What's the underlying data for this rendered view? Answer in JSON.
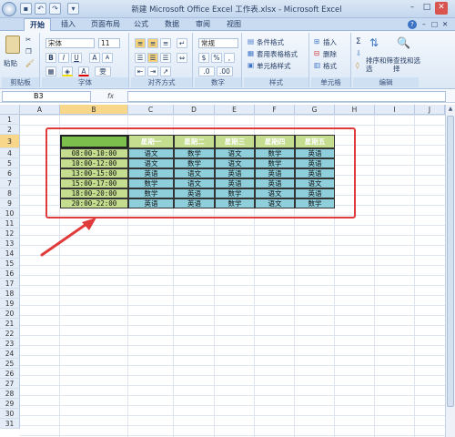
{
  "window": {
    "title": "新建 Microsoft Office Excel 工作表.xlsx - Microsoft Excel"
  },
  "tabs": [
    "开始",
    "插入",
    "页面布局",
    "公式",
    "数据",
    "审阅",
    "视图"
  ],
  "ribbon": {
    "clipboard": {
      "paste": "粘贴",
      "label": "剪贴板"
    },
    "font": {
      "name": "宋体",
      "size": "11",
      "label": "字体"
    },
    "alignment": {
      "label": "对齐方式"
    },
    "number": {
      "format": "常规",
      "label": "数字"
    },
    "styles": {
      "cond": "条件格式",
      "table": "套用表格格式",
      "cell": "单元格样式",
      "label": "样式"
    },
    "cells": {
      "insert": "插入",
      "delete": "删除",
      "format": "格式",
      "label": "单元格"
    },
    "editing": {
      "sort": "排序和筛选",
      "find": "查找和选择",
      "label": "编辑"
    }
  },
  "formula_bar": {
    "name_box": "B3",
    "fx": "fx",
    "content": ""
  },
  "columns": [
    "A",
    "B",
    "C",
    "D",
    "E",
    "F",
    "G",
    "H",
    "I",
    "J"
  ],
  "rows": [
    "1",
    "2",
    "3",
    "4",
    "5",
    "6",
    "7",
    "8",
    "9",
    "10",
    "11",
    "12",
    "13",
    "14",
    "15",
    "16",
    "17",
    "18",
    "19",
    "20",
    "21",
    "22",
    "23",
    "24",
    "25",
    "26",
    "27",
    "28",
    "29",
    "30",
    "31"
  ],
  "table": {
    "days": [
      "星期一",
      "星期二",
      "星期三",
      "星期四",
      "星期五"
    ],
    "rows": [
      {
        "time": "08:00-10:00",
        "subjects": [
          "语文",
          "数学",
          "语文",
          "数学",
          "英语"
        ]
      },
      {
        "time": "10:00-12:00",
        "subjects": [
          "语文",
          "数学",
          "语文",
          "数学",
          "英语"
        ]
      },
      {
        "time": "13:00-15:00",
        "subjects": [
          "英语",
          "语文",
          "英语",
          "英语",
          "英语"
        ]
      },
      {
        "time": "15:00-17:00",
        "subjects": [
          "数学",
          "语文",
          "英语",
          "英语",
          "语文"
        ]
      },
      {
        "time": "18:00-20:00",
        "subjects": [
          "数学",
          "英语",
          "数学",
          "语文",
          "英语"
        ]
      },
      {
        "time": "20:00-22:00",
        "subjects": [
          "英语",
          "英语",
          "数学",
          "语文",
          "数学"
        ]
      }
    ]
  }
}
